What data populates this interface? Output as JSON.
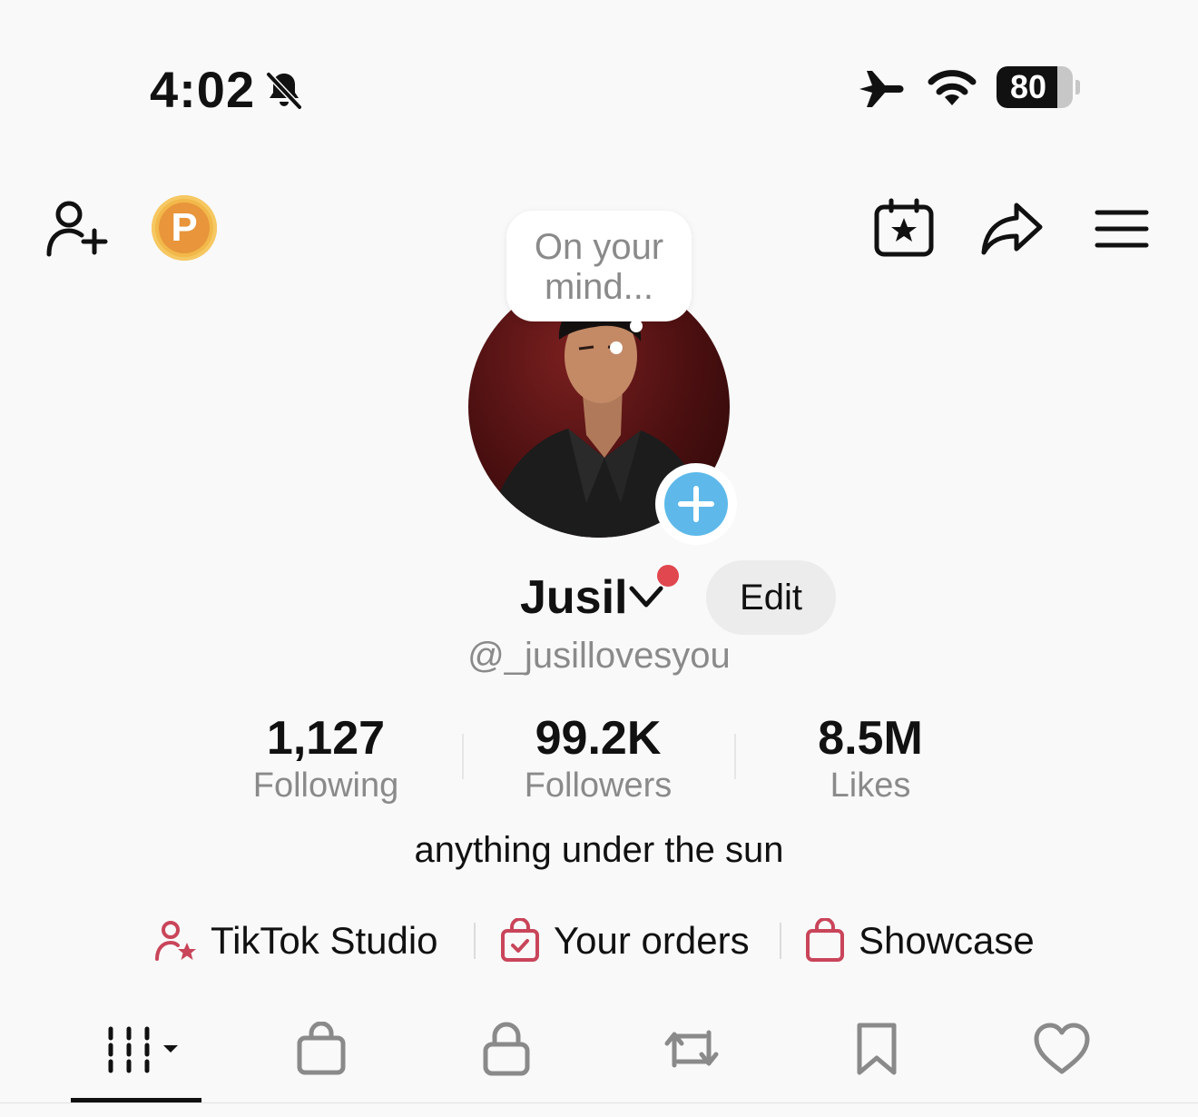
{
  "status_bar": {
    "time": "4:02",
    "battery_level": "80",
    "battery_fraction": 0.8,
    "icons": [
      "bell-muted-icon",
      "airplane-icon",
      "wifi-icon",
      "battery-icon"
    ]
  },
  "toolbar": {
    "left_icons": [
      "add-friend-icon",
      "coin-icon"
    ],
    "coin_letter": "P",
    "right_icons": [
      "calendar-star-icon",
      "share-icon",
      "menu-icon"
    ]
  },
  "profile": {
    "thought_bubble": "On your mind...",
    "display_name": "Jusil",
    "edit_label": "Edit",
    "handle": "@_jusillovesyou",
    "bio": "anything under the sun"
  },
  "stats": [
    {
      "value": "1,127",
      "label": "Following"
    },
    {
      "value": "99.2K",
      "label": "Followers"
    },
    {
      "value": "8.5M",
      "label": "Likes"
    }
  ],
  "links": [
    {
      "label": "TikTok Studio",
      "icon": "studio-user-star-icon"
    },
    {
      "label": "Your orders",
      "icon": "orders-bag-check-icon"
    },
    {
      "label": "Showcase",
      "icon": "showcase-bag-icon"
    }
  ],
  "tabs": [
    {
      "name": "videos",
      "icon": "grid-icon",
      "active": true
    },
    {
      "name": "shop",
      "icon": "shopping-bag-icon",
      "active": false
    },
    {
      "name": "private",
      "icon": "lock-icon",
      "active": false
    },
    {
      "name": "reposts",
      "icon": "repost-icon",
      "active": false
    },
    {
      "name": "favorites",
      "icon": "bookmark-icon",
      "active": false
    },
    {
      "name": "liked",
      "icon": "heart-icon",
      "active": false
    }
  ],
  "colors": {
    "accent_red": "#e0474f",
    "link_icon_red": "#c9455a",
    "add_badge_blue": "#5eb9ea",
    "coin_orange": "#e8953b",
    "secondary_text": "#8a8a8a"
  }
}
